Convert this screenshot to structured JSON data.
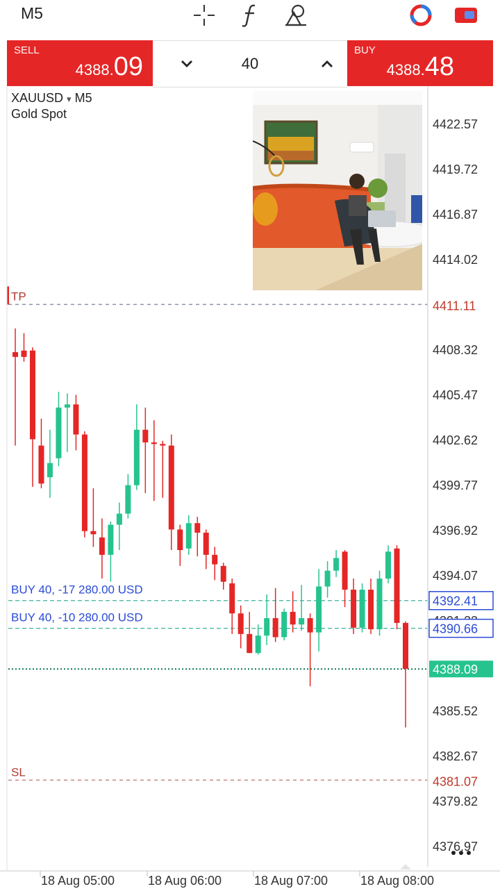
{
  "timeframe": "M5",
  "toolbar": {
    "icons": [
      "crosshair-icon",
      "indicators-f-icon",
      "objects-icon",
      "connection-status-icon",
      "account-icon"
    ]
  },
  "trade": {
    "sell_label": "SELL",
    "sell_price_small": "4388.",
    "sell_price_large": "09",
    "buy_label": "BUY",
    "buy_price_small": "4388.",
    "buy_price_large": "48",
    "lot": "40"
  },
  "symbol": {
    "name": "XAUUSD",
    "arrow": "▾",
    "timeframe": "M5",
    "description": "Gold Spot"
  },
  "labels": {
    "tp": "TP",
    "sl": "SL",
    "order1": "BUY 40, -17 280.00 USD",
    "order2": "BUY 40, -10 280.00 USD"
  },
  "colors": {
    "bull": "#26c38f",
    "bear": "#e52626",
    "order_line": "#2a4bd7",
    "bid_line": "#0b7a55",
    "level_line": "#c0392b"
  },
  "chart_data": {
    "type": "candlestick",
    "symbol": "XAUUSD",
    "timeframe": "M5",
    "ylim": [
      4375.6,
      4424.9
    ],
    "y_ticks": [
      "4422.57",
      "4419.72",
      "4416.87",
      "4414.02",
      "4408.32",
      "4405.47",
      "4402.62",
      "4399.77",
      "4396.92",
      "4394.07",
      "4385.52",
      "4382.67",
      "4379.82",
      "4376.97"
    ],
    "x_labels": [
      "18 Aug 05:00",
      "18 Aug 06:00",
      "18 Aug 07:00",
      "18 Aug 08:00"
    ],
    "levels": {
      "tp": "4411.11",
      "sl": "4381.07",
      "order1": "4392.41",
      "order2": "4390.66",
      "bid": "4388.09",
      "obscured": "4391.22"
    },
    "candles": [
      {
        "o": 4408.1,
        "h": 4409.6,
        "l": 4402.2,
        "c": 4407.8
      },
      {
        "o": 4408.2,
        "h": 4409.3,
        "l": 4407.5,
        "c": 4407.8
      },
      {
        "o": 4408.2,
        "h": 4408.4,
        "l": 4399.6,
        "c": 4402.6
      },
      {
        "o": 4402.2,
        "h": 4403.9,
        "l": 4399.5,
        "c": 4399.8
      },
      {
        "o": 4400.2,
        "h": 4403.2,
        "l": 4398.9,
        "c": 4401.1
      },
      {
        "o": 4401.4,
        "h": 4405.6,
        "l": 4400.9,
        "c": 4404.6
      },
      {
        "o": 4404.6,
        "h": 4405.5,
        "l": 4401.8,
        "c": 4404.8
      },
      {
        "o": 4404.8,
        "h": 4405.4,
        "l": 4401.9,
        "c": 4402.9
      },
      {
        "o": 4402.9,
        "h": 4403.1,
        "l": 4396.4,
        "c": 4396.8
      },
      {
        "o": 4396.8,
        "h": 4399.5,
        "l": 4395.8,
        "c": 4396.6
      },
      {
        "o": 4396.4,
        "h": 4397.6,
        "l": 4393.8,
        "c": 4395.3
      },
      {
        "o": 4395.3,
        "h": 4397.4,
        "l": 4393.6,
        "c": 4397.2
      },
      {
        "o": 4397.2,
        "h": 4398.6,
        "l": 4395.6,
        "c": 4397.9
      },
      {
        "o": 4397.9,
        "h": 4400.4,
        "l": 4397.6,
        "c": 4399.7
      },
      {
        "o": 4399.7,
        "h": 4404.8,
        "l": 4399.4,
        "c": 4403.2
      },
      {
        "o": 4403.2,
        "h": 4404.6,
        "l": 4399.2,
        "c": 4402.4
      },
      {
        "o": 4402.4,
        "h": 4403.8,
        "l": 4398.7,
        "c": 4402.3
      },
      {
        "o": 4402.3,
        "h": 4402.5,
        "l": 4398.9,
        "c": 4402.2
      },
      {
        "o": 4402.2,
        "h": 4402.9,
        "l": 4395.6,
        "c": 4396.9
      },
      {
        "o": 4396.9,
        "h": 4397.2,
        "l": 4394.6,
        "c": 4395.6
      },
      {
        "o": 4395.7,
        "h": 4397.8,
        "l": 4395.3,
        "c": 4397.3
      },
      {
        "o": 4397.3,
        "h": 4397.7,
        "l": 4395.2,
        "c": 4396.7
      },
      {
        "o": 4396.7,
        "h": 4396.9,
        "l": 4394.4,
        "c": 4395.3
      },
      {
        "o": 4395.3,
        "h": 4395.8,
        "l": 4393.7,
        "c": 4394.7
      },
      {
        "o": 4394.6,
        "h": 4394.8,
        "l": 4393.1,
        "c": 4393.6
      },
      {
        "o": 4393.5,
        "h": 4393.8,
        "l": 4390.3,
        "c": 4391.6
      },
      {
        "o": 4391.6,
        "h": 4392.1,
        "l": 4389.4,
        "c": 4390.3
      },
      {
        "o": 4390.3,
        "h": 4391.7,
        "l": 4389.1,
        "c": 4389.1
      },
      {
        "o": 4389.1,
        "h": 4390.9,
        "l": 4389.0,
        "c": 4390.2
      },
      {
        "o": 4390.2,
        "h": 4392.8,
        "l": 4389.6,
        "c": 4391.3
      },
      {
        "o": 4391.3,
        "h": 4393.2,
        "l": 4389.8,
        "c": 4390.1
      },
      {
        "o": 4390.1,
        "h": 4391.9,
        "l": 4389.9,
        "c": 4391.7
      },
      {
        "o": 4391.7,
        "h": 4393.0,
        "l": 4390.4,
        "c": 4390.9
      },
      {
        "o": 4390.9,
        "h": 4393.4,
        "l": 4390.5,
        "c": 4391.3
      },
      {
        "o": 4391.3,
        "h": 4391.6,
        "l": 4387.0,
        "c": 4390.4
      },
      {
        "o": 4390.4,
        "h": 4394.4,
        "l": 4389.2,
        "c": 4393.3
      },
      {
        "o": 4393.3,
        "h": 4394.9,
        "l": 4392.6,
        "c": 4394.3
      },
      {
        "o": 4394.3,
        "h": 4395.6,
        "l": 4393.9,
        "c": 4395.1
      },
      {
        "o": 4395.5,
        "h": 4395.6,
        "l": 4392.0,
        "c": 4393.1
      },
      {
        "o": 4393.1,
        "h": 4393.8,
        "l": 4390.3,
        "c": 4390.7
      },
      {
        "o": 4390.7,
        "h": 4393.5,
        "l": 4390.4,
        "c": 4393.1
      },
      {
        "o": 4393.1,
        "h": 4393.8,
        "l": 4390.3,
        "c": 4390.6
      },
      {
        "o": 4390.6,
        "h": 4394.3,
        "l": 4390.2,
        "c": 4393.8
      },
      {
        "o": 4393.8,
        "h": 4395.9,
        "l": 4393.5,
        "c": 4395.5
      },
      {
        "o": 4395.7,
        "h": 4395.9,
        "l": 4390.6,
        "c": 4391.0
      },
      {
        "o": 4391.0,
        "h": 4391.1,
        "l": 4384.4,
        "c": 4388.1
      }
    ]
  }
}
